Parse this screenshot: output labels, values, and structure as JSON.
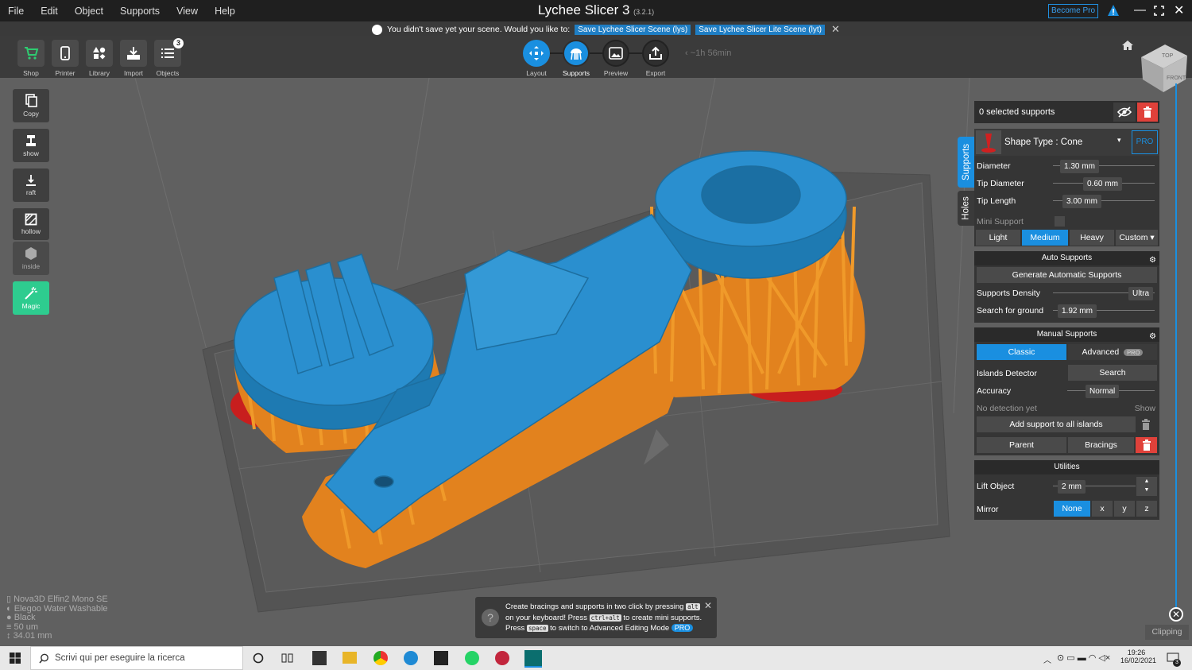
{
  "menu": [
    "File",
    "Edit",
    "Object",
    "Supports",
    "View",
    "Help"
  ],
  "app": {
    "title": "Lychee Slicer 3",
    "version": "(3.2.1)",
    "become_pro": "Become Pro"
  },
  "savebar": {
    "message": "You didn't save yet your scene. Would you like to:",
    "opt1": "Save Lychee Slicer Scene (lys)",
    "opt2": "Save Lychee Slicer Lite Scene (lyt)"
  },
  "toolbar": {
    "left": [
      "Shop",
      "Printer",
      "Library",
      "Import",
      "Objects"
    ],
    "objects_count": "3",
    "modes": [
      "Layout",
      "Supports",
      "Preview",
      "Export"
    ],
    "eta": "~1h 56min"
  },
  "viewcube": {
    "top": "TOP",
    "front": "FRONT"
  },
  "left_tools": [
    "Copy",
    "show",
    "raft",
    "hollow",
    "inside",
    "Magic"
  ],
  "printer_info": [
    "Nova3D Elfin2 Mono SE",
    "Elegoo Water Washable",
    "Black",
    "50 um",
    "34.01 mm"
  ],
  "side_tabs": {
    "supports": "Supports",
    "holes": "Holes"
  },
  "panel": {
    "selected": "0 selected supports",
    "shape_type": "Shape Type : Cone",
    "pro": "PRO",
    "diameter_label": "Diameter",
    "diameter": "1.30 mm",
    "tip_diameter_label": "Tip Diameter",
    "tip_diameter": "0.60 mm",
    "tip_length_label": "Tip Length",
    "tip_length": "3.00 mm",
    "mini_support": "Mini Support",
    "presets": [
      "Light",
      "Medium",
      "Heavy",
      "Custom ▾"
    ],
    "auto_title": "Auto Supports",
    "generate": "Generate Automatic Supports",
    "density_label": "Supports Density",
    "density": "Ultra",
    "ground_label": "Search for ground",
    "ground": "1.92 mm",
    "manual_title": "Manual Supports",
    "classic": "Classic",
    "advanced": "Advanced",
    "islands_label": "Islands Detector",
    "islands_btn": "Search",
    "accuracy_label": "Accuracy",
    "accuracy": "Normal",
    "no_detection": "No detection yet",
    "show": "Show",
    "add_all": "Add support to all islands",
    "parent": "Parent",
    "bracings": "Bracings",
    "utilities_title": "Utilities",
    "lift_label": "Lift Object",
    "lift": "2 mm",
    "mirror_label": "Mirror",
    "mirror": [
      "None",
      "x",
      "y",
      "z"
    ]
  },
  "tip": {
    "l1a": "Create bracings and supports in two click by pressing",
    "k1": "alt",
    "l2a": "on your keyboard! Press",
    "k2": "ctrl+alt",
    "l2b": "to create mini supports.",
    "l3a": "Press",
    "k3": "space",
    "l3b": "to switch to Advanced Editing Mode",
    "pro": "PRO"
  },
  "clipping": "Clipping",
  "taskbar": {
    "search": "Scrivi qui per eseguire la ricerca",
    "time": "19:26",
    "date": "16/02/2021",
    "notif": "3"
  },
  "colors": {
    "accent": "#1a8fe0",
    "model": "#2a8fcf",
    "supports": "#e58a1f",
    "danger": "#e0413a"
  }
}
